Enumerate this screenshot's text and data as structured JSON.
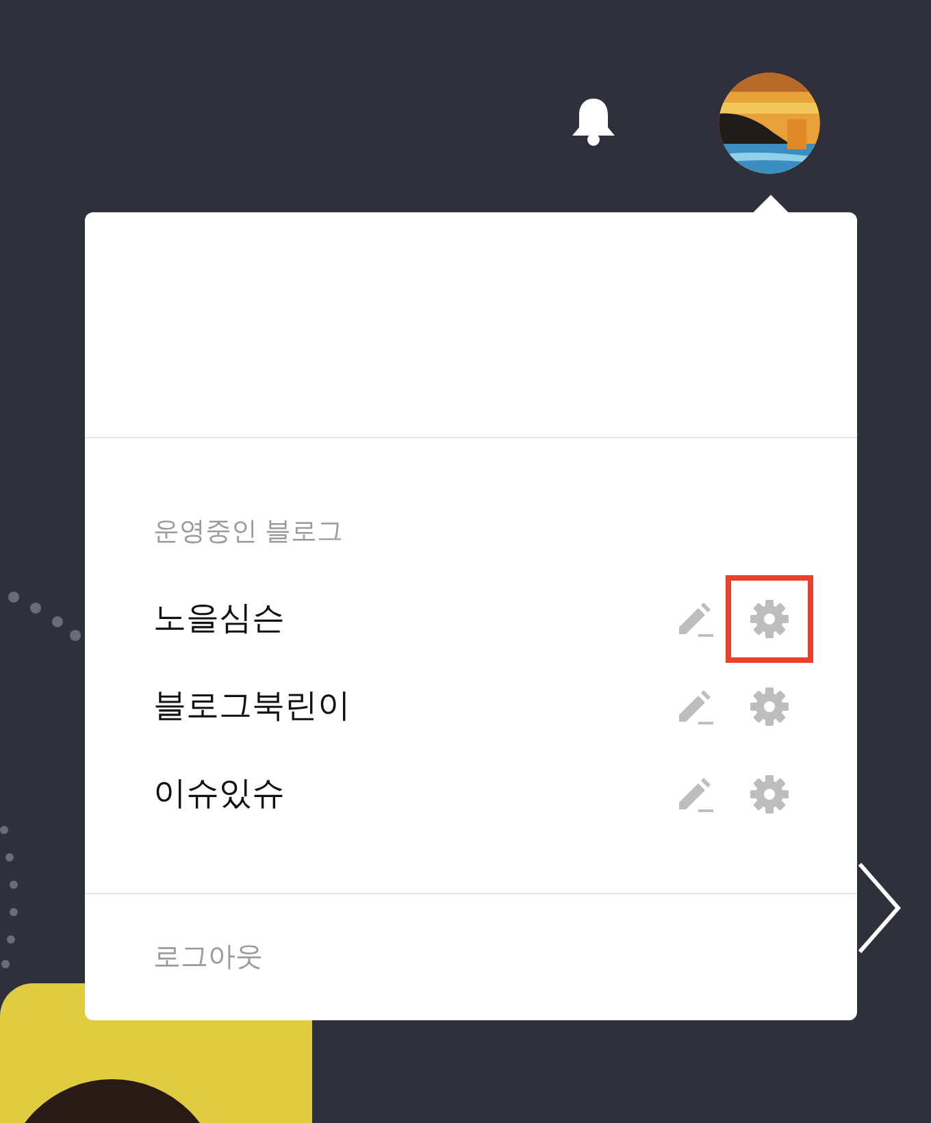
{
  "menu": {
    "section_label": "운영중인 블로그",
    "blogs": [
      {
        "name": "노을심슨",
        "highlighted": true
      },
      {
        "name": "블로그북린이",
        "highlighted": false
      },
      {
        "name": "이슈있슈",
        "highlighted": false
      }
    ],
    "logout": "로그아웃"
  }
}
